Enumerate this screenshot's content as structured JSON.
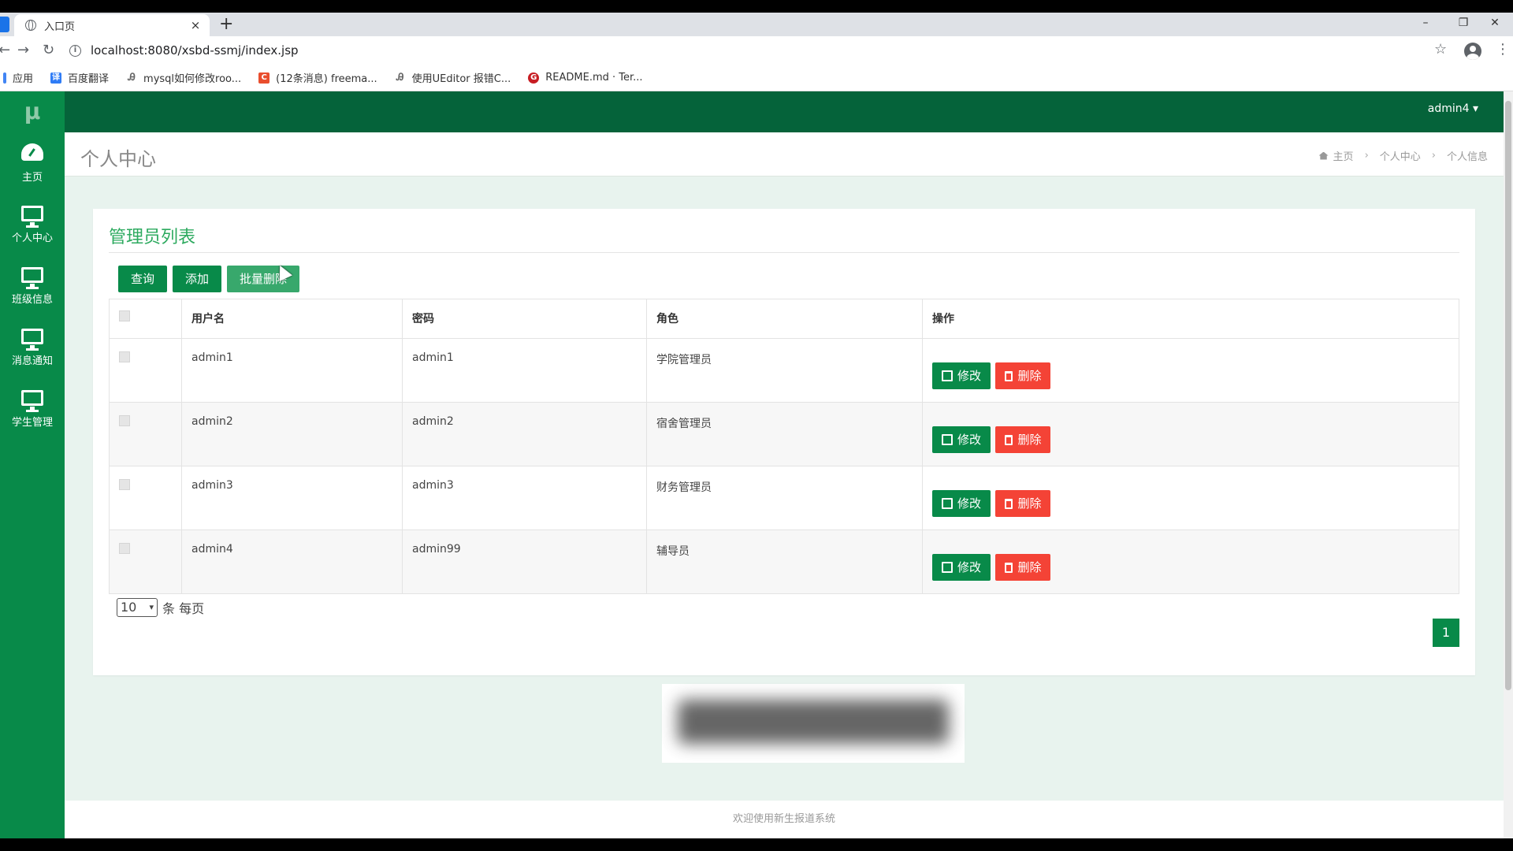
{
  "browser": {
    "tab_title": "入口页",
    "tab_close": "×",
    "new_tab": "+",
    "url": "localhost:8080/xsbd-ssmj/index.jsp",
    "window_controls": [
      "–",
      "❐",
      "✕"
    ],
    "bookmarks": [
      {
        "label": "应用",
        "icon": "apps-icon",
        "color": "#4285f4"
      },
      {
        "label": "百度翻译",
        "icon": "baidu-translate-icon",
        "color": "#2f7cf6"
      },
      {
        "label": "mysql如何修改roo...",
        "icon": "site-icon",
        "color": "#666666"
      },
      {
        "label": "(12条消息) freema...",
        "icon": "csdn-icon",
        "color": "#e94e2e"
      },
      {
        "label": "使用UEditor 报错C...",
        "icon": "site-icon",
        "color": "#666666"
      },
      {
        "label": "README.md · Ter...",
        "icon": "gitee-icon",
        "color": "#c71d23"
      }
    ]
  },
  "app": {
    "logo": "μ",
    "user": "admin4 ▾",
    "sidebar": [
      {
        "label": "主页",
        "icon": "dashboard-icon"
      },
      {
        "label": "个人中心",
        "icon": "monitor-icon"
      },
      {
        "label": "班级信息",
        "icon": "monitor-icon"
      },
      {
        "label": "消息通知",
        "icon": "monitor-icon"
      },
      {
        "label": "学生管理",
        "icon": "monitor-icon"
      }
    ],
    "page_title": "个人中心",
    "breadcrumb": [
      "主页",
      "个人中心",
      "个人信息"
    ],
    "breadcrumb_sep": "›",
    "panel_title": "管理员列表",
    "buttons": {
      "query": "查询",
      "add": "添加",
      "batch_delete": "批量删除"
    },
    "table": {
      "headers": [
        "用户名",
        "密码",
        "角色",
        "操作"
      ],
      "rows": [
        {
          "username": "admin1",
          "password": "admin1",
          "role": "学院管理员"
        },
        {
          "username": "admin2",
          "password": "admin2",
          "role": "宿舍管理员"
        },
        {
          "username": "admin3",
          "password": "admin3",
          "role": "财务管理员"
        },
        {
          "username": "admin4",
          "password": "admin99",
          "role": "辅导员"
        }
      ],
      "edit_label": "修改",
      "delete_label": "删除"
    },
    "page_size": "10",
    "page_size_caret": "▾",
    "page_size_suffix": "条 每页",
    "current_page": "1",
    "footer": "欢迎使用新生报道系统"
  },
  "colors": {
    "brand_green": "#088a49",
    "header_green": "#05633a",
    "danger_red": "#f44336",
    "title_green": "#2daa5f"
  }
}
